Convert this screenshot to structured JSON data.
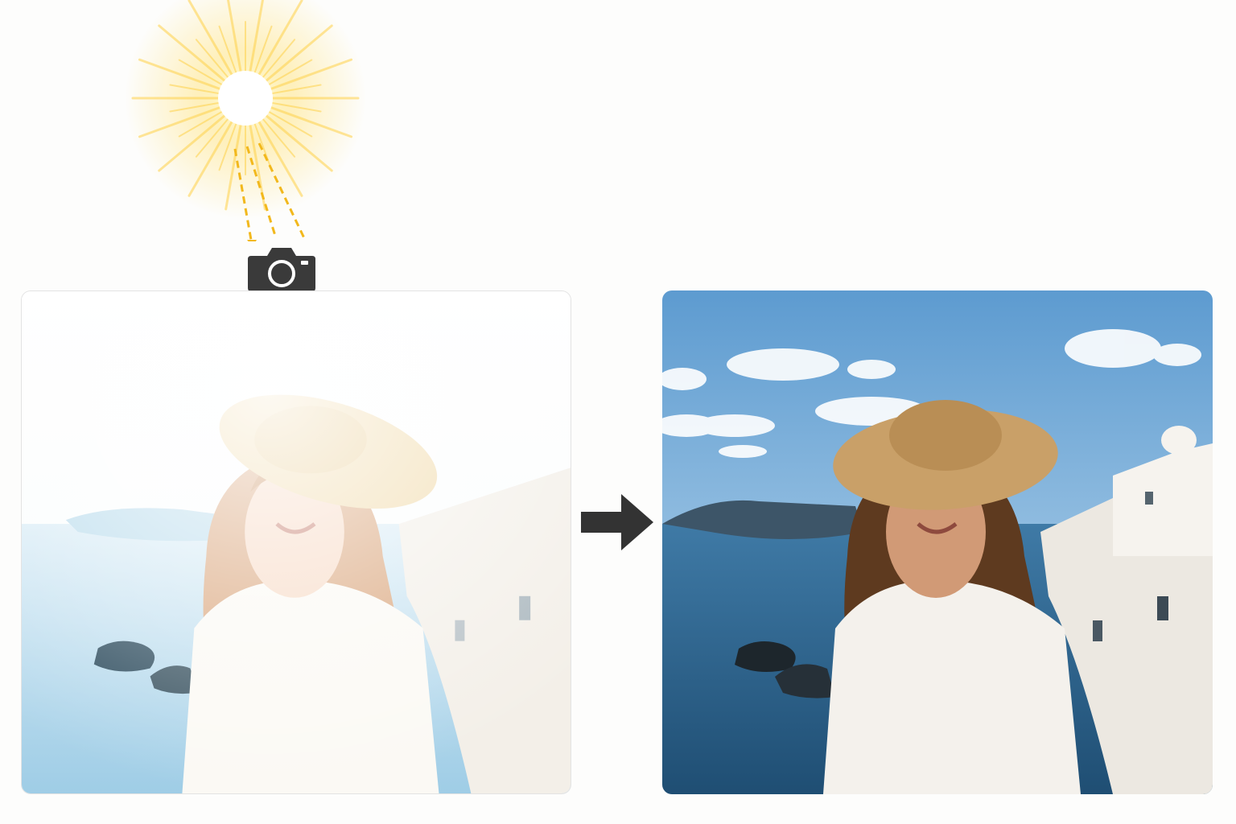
{
  "scene": {
    "sun_icon": "sun-icon",
    "camera_icon": "camera-icon",
    "arrow_icon": "right-arrow-icon",
    "before_state": "overexposed",
    "after_state": "corrected"
  },
  "colors": {
    "background": "#fdfdfc",
    "sun_core": "#ffffff",
    "sun_glow": "#ffd84a",
    "ray_arrow": "#f2b81c",
    "camera": "#3a3a3a",
    "arrow": "#333333",
    "sky": "#7aaed8",
    "sea": "#2f5f86",
    "hat": "#c9a068",
    "hair": "#6a4326",
    "dress": "#f4f1ec"
  }
}
